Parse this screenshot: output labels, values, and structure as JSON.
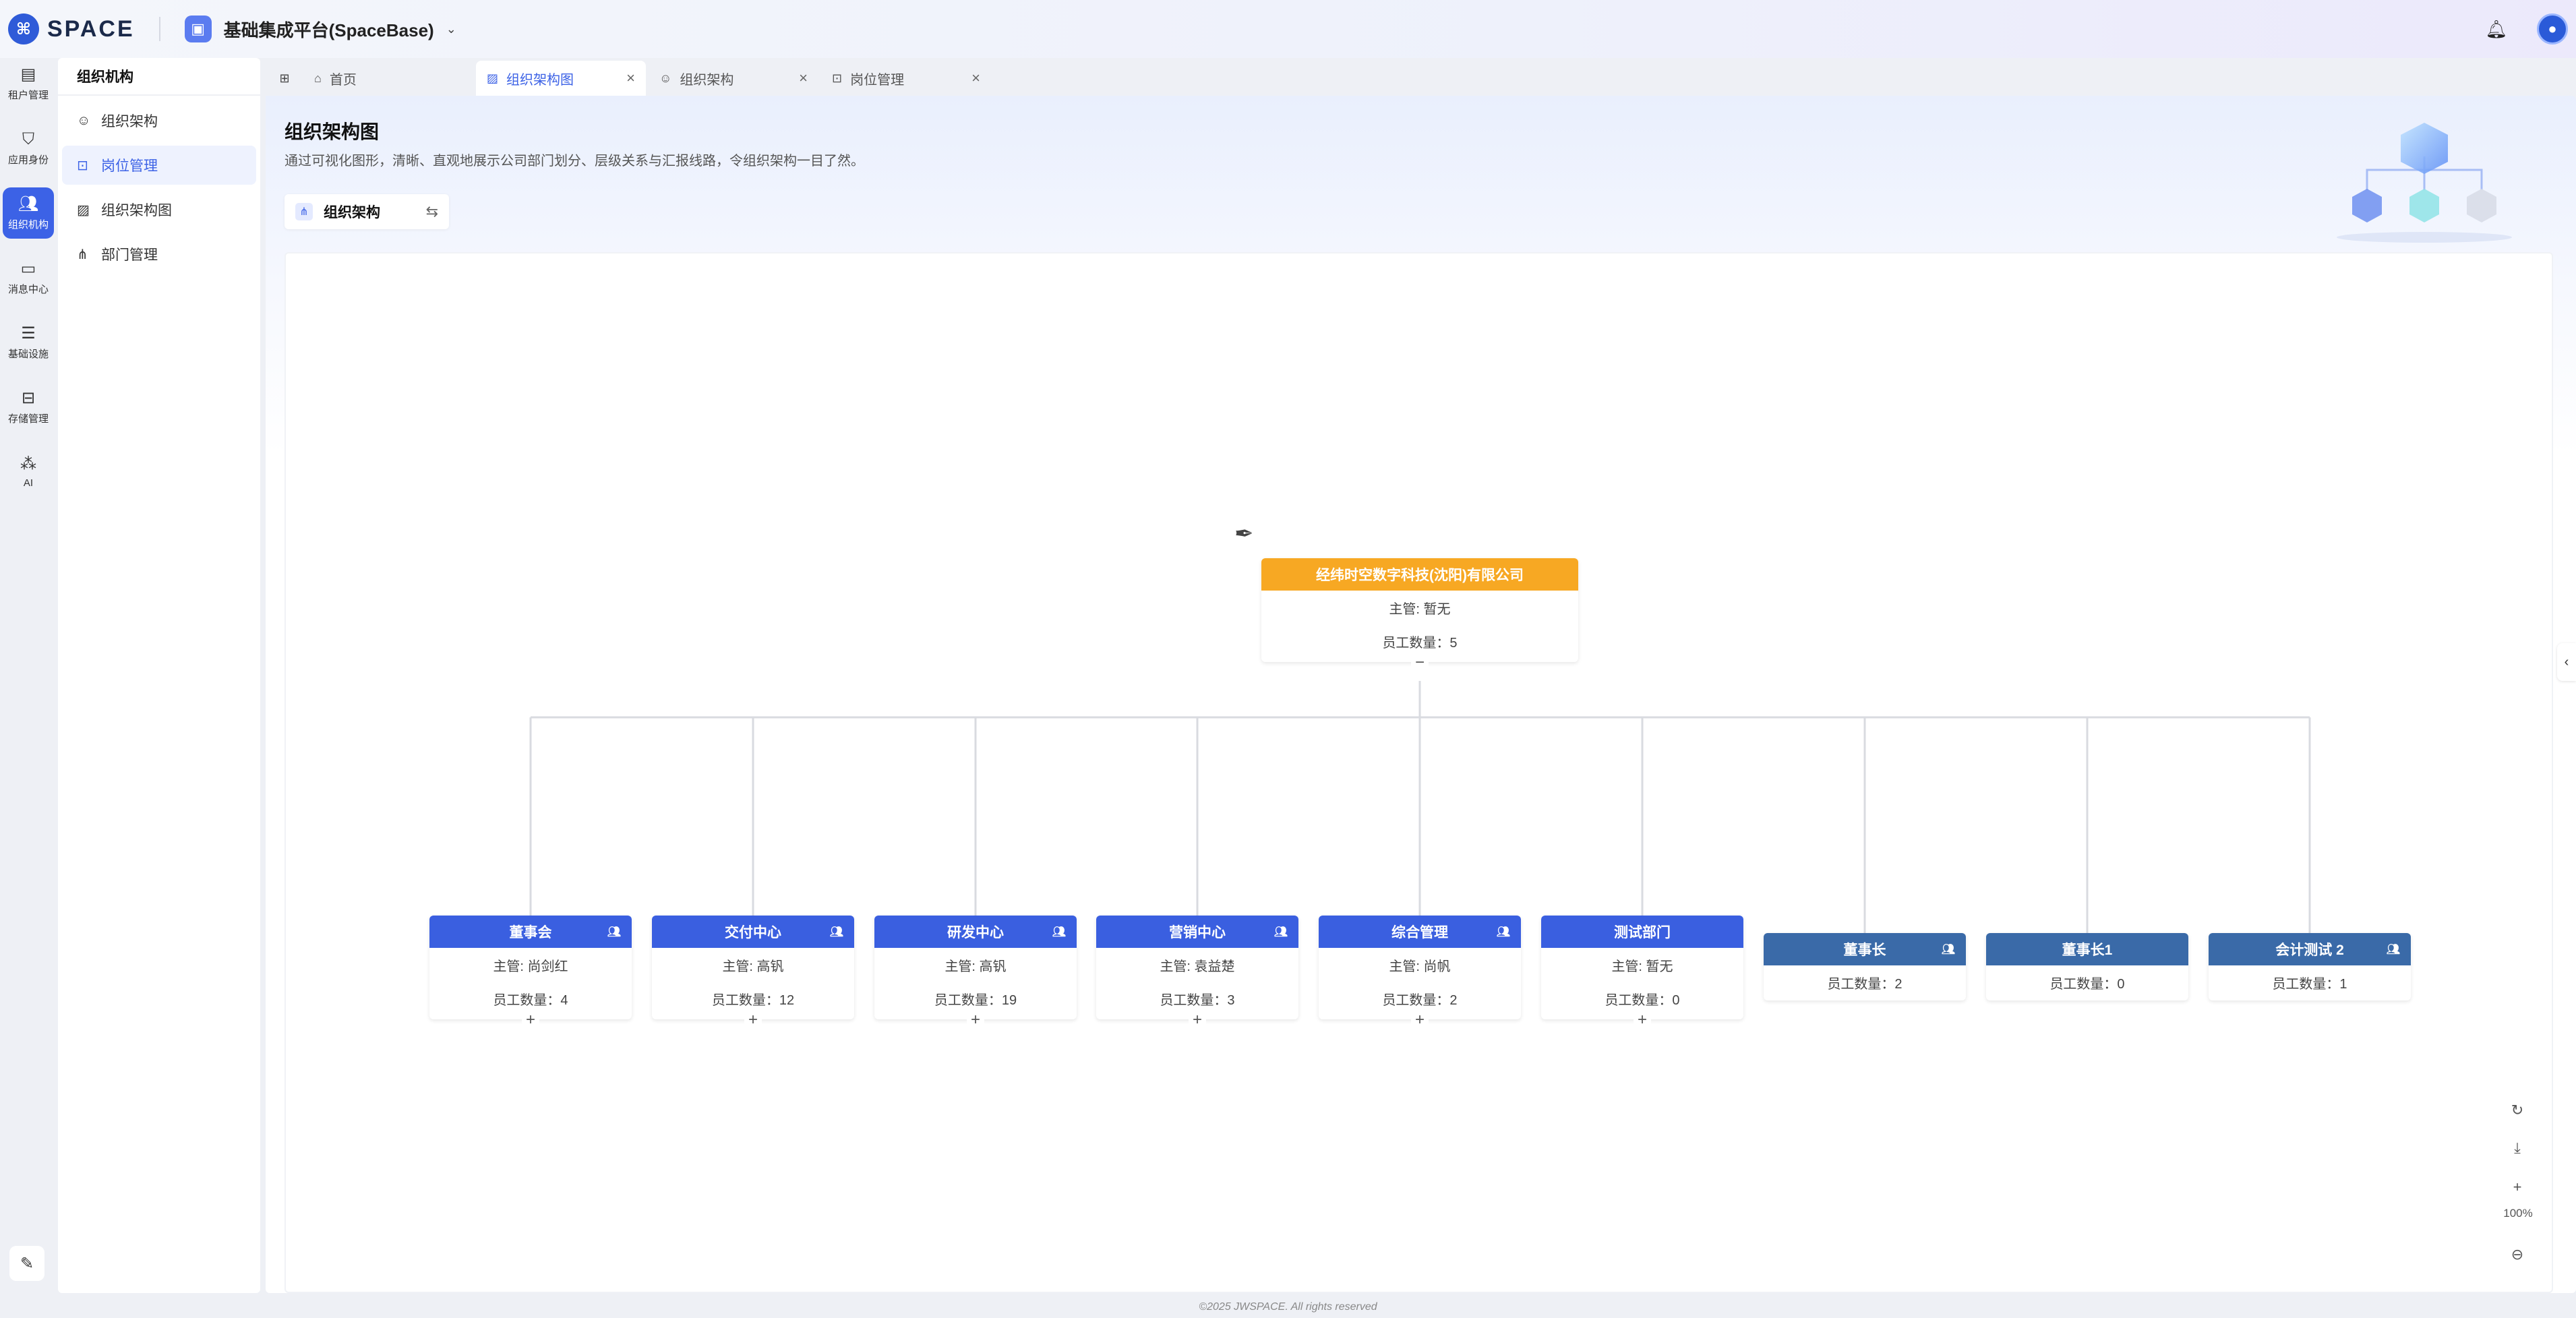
{
  "brand": {
    "name": "SPACE"
  },
  "platform": {
    "name": "基础集成平台(SpaceBase)"
  },
  "rail": [
    {
      "label": "租户管理",
      "icon": "tenant-icon"
    },
    {
      "label": "应用身份",
      "icon": "app-identity-icon"
    },
    {
      "label": "组织机构",
      "icon": "organization-icon",
      "active": true
    },
    {
      "label": "消息中心",
      "icon": "message-icon"
    },
    {
      "label": "基础设施",
      "icon": "settings-sliders-icon"
    },
    {
      "label": "存储管理",
      "icon": "storage-icon"
    },
    {
      "label": "AI",
      "icon": "ai-icon"
    }
  ],
  "submenu": {
    "title": "组织机构",
    "items": [
      {
        "label": "组织架构",
        "icon": "user-icon"
      },
      {
        "label": "岗位管理",
        "icon": "briefcase-icon",
        "active": true
      },
      {
        "label": "组织架构图",
        "icon": "image-icon"
      },
      {
        "label": "部门管理",
        "icon": "tree-icon"
      }
    ]
  },
  "tabs": [
    {
      "label": "首页",
      "icon": "home-icon",
      "closable": false
    },
    {
      "label": "组织架构图",
      "icon": "image-icon",
      "closable": true,
      "active": true
    },
    {
      "label": "组织架构",
      "icon": "user-icon",
      "closable": true
    },
    {
      "label": "岗位管理",
      "icon": "briefcase-icon",
      "closable": true
    }
  ],
  "page": {
    "title": "组织架构图",
    "description": "通过可视化图形，清晰、直观地展示公司部门划分、层级关系与汇报线路，令组织架构一目了然。",
    "switcher_label": "组织架构"
  },
  "chart": {
    "root": {
      "name": "经纬时空数字科技(沈阳)有限公司",
      "manager": "主管: 暂无",
      "count": "员工数量：5",
      "toggle": "−"
    },
    "children": [
      {
        "name": "董事会",
        "manager": "主管: 尚剑红",
        "count": "员工数量：4",
        "type": "dept"
      },
      {
        "name": "交付中心",
        "manager": "主管: 高钒",
        "count": "员工数量：12",
        "type": "dept"
      },
      {
        "name": "研发中心",
        "manager": "主管: 高钒",
        "count": "员工数量：19",
        "type": "dept"
      },
      {
        "name": "营销中心",
        "manager": "主管: 袁益楚",
        "count": "员工数量：3",
        "type": "dept"
      },
      {
        "name": "综合管理",
        "manager": "主管: 尚帆",
        "count": "员工数量：2",
        "type": "dept"
      },
      {
        "name": "测试部门",
        "manager": "主管: 暂无",
        "count": "员工数量：0",
        "type": "dept"
      },
      {
        "name": "董事长",
        "count": "员工数量：2",
        "type": "pos"
      },
      {
        "name": "董事长1",
        "count": "员工数量：0",
        "type": "pos"
      },
      {
        "name": "会计测试 2",
        "count": "员工数量：1",
        "type": "pos"
      }
    ]
  },
  "controls": {
    "zoom": "100%"
  },
  "footer": "©2025 JWSPACE. All rights reserved",
  "colors": {
    "accent": "#3c62e6",
    "root_header": "#f7a823",
    "dept_header": "#3a5fe0",
    "position_header": "#3a6aa8"
  }
}
